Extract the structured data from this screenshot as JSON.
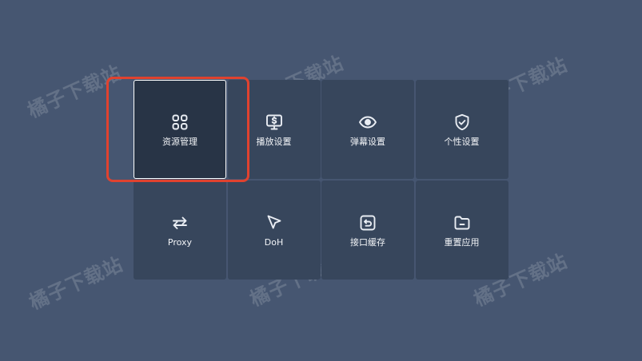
{
  "watermark_text": "橘子下载站",
  "menu": {
    "tiles": [
      {
        "label": "资源管理",
        "icon": "grid-apps-icon",
        "selected": true
      },
      {
        "label": "播放设置",
        "icon": "monitor-dollar-icon",
        "selected": false
      },
      {
        "label": "弹幕设置",
        "icon": "eye-icon",
        "selected": false
      },
      {
        "label": "个性设置",
        "icon": "shield-check-icon",
        "selected": false
      },
      {
        "label": "Proxy",
        "icon": "swap-arrows-icon",
        "selected": false
      },
      {
        "label": "DoH",
        "icon": "cursor-pointer-icon",
        "selected": false
      },
      {
        "label": "接口缓存",
        "icon": "restore-box-icon",
        "selected": false
      },
      {
        "label": "重置应用",
        "icon": "folder-icon",
        "selected": false
      }
    ]
  },
  "colors": {
    "background": "#465671",
    "tile": "#37465c",
    "tile_selected": "#283446",
    "highlight": "#e0422f"
  }
}
